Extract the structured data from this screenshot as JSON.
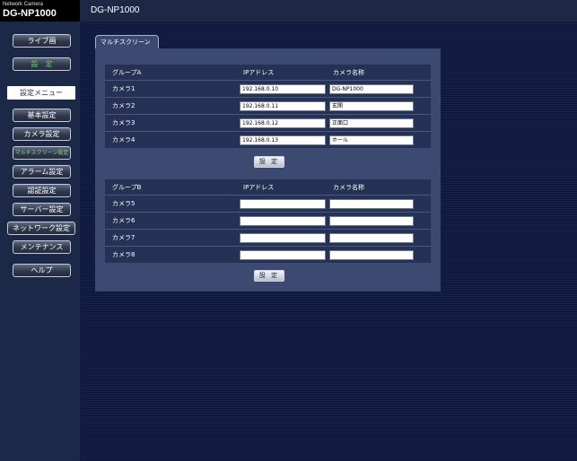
{
  "brand": {
    "small": "Network Camera",
    "model": "DG-NP1000"
  },
  "header": {
    "title": "DG-NP1000"
  },
  "sidebar": {
    "live_button": "ライブ画",
    "setup_button": "設　定",
    "menu_label": "設定メニュー",
    "items": [
      {
        "label": "基本設定"
      },
      {
        "label": "カメラ設定"
      },
      {
        "label": "マルチスクリーン設定"
      },
      {
        "label": "アラーム設定"
      },
      {
        "label": "認証設定"
      },
      {
        "label": "サーバー設定"
      },
      {
        "label": "ネットワーク設定"
      },
      {
        "label": "メンテナンス"
      },
      {
        "label": "ヘルプ"
      }
    ]
  },
  "tab": {
    "label": "マルチスクリーン"
  },
  "group_a": {
    "headers": [
      "グループA",
      "IPアドレス",
      "カメラ名称"
    ],
    "rows": [
      {
        "camera": "カメラ1",
        "ip": "192.168.0.10",
        "name": "DG-NP1000"
      },
      {
        "camera": "カメラ2",
        "ip": "192.168.0.11",
        "name": "玄関"
      },
      {
        "camera": "カメラ3",
        "ip": "192.168.0.12",
        "name": "正面口"
      },
      {
        "camera": "カメラ4",
        "ip": "192.168.0.13",
        "name": "ホール"
      }
    ],
    "set_button": "設 定"
  },
  "group_b": {
    "headers": [
      "グループB",
      "IPアドレス",
      "カメラ名称"
    ],
    "rows": [
      {
        "camera": "カメラ5",
        "ip": "",
        "name": ""
      },
      {
        "camera": "カメラ6",
        "ip": "",
        "name": ""
      },
      {
        "camera": "カメラ7",
        "ip": "",
        "name": ""
      },
      {
        "camera": "カメラ8",
        "ip": "",
        "name": ""
      }
    ],
    "set_button": "設 定"
  }
}
